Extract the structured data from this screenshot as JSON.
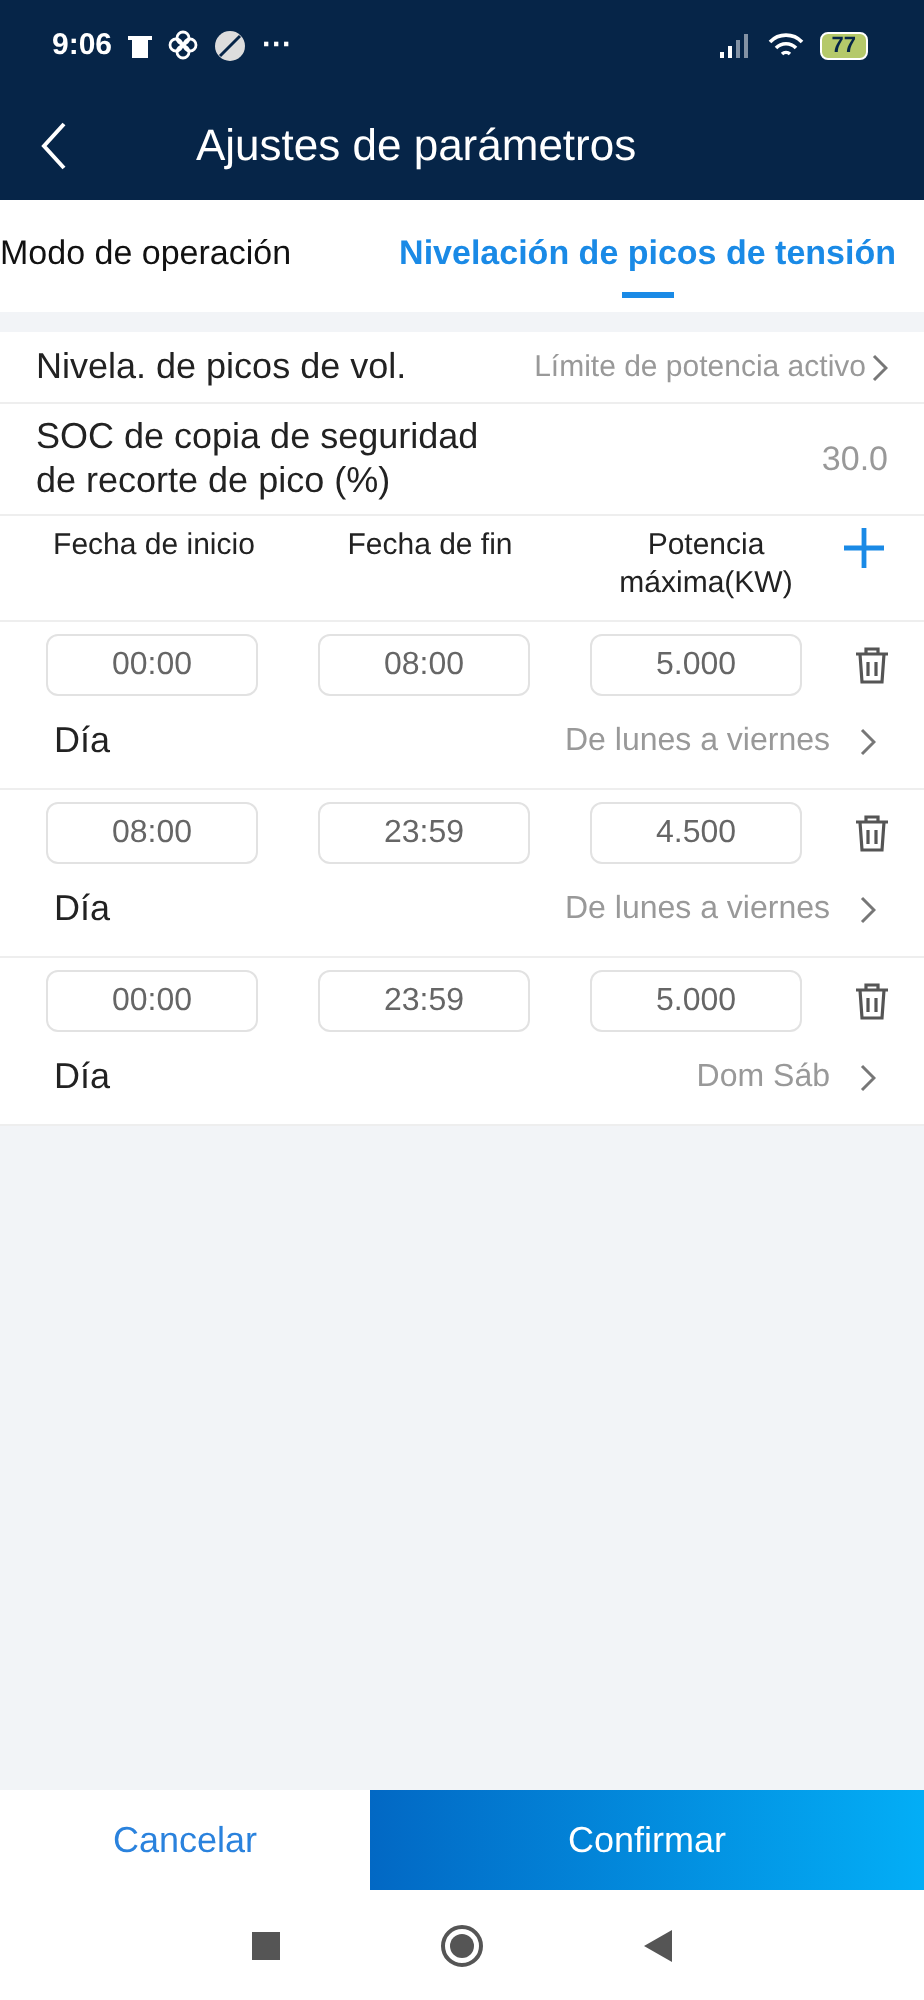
{
  "status_bar": {
    "time": "9:06",
    "more": "···",
    "battery": "77"
  },
  "header": {
    "title": "Ajustes de parámetros"
  },
  "tabs": [
    {
      "label": "Modo de operación",
      "selected": false
    },
    {
      "label": "Nivelación de picos de tensión",
      "selected": true
    }
  ],
  "settings": [
    {
      "label": "Nivela. de picos de vol.",
      "value": "Límite de potencia activo",
      "kind": "select"
    },
    {
      "label": "SOC de copia de seguridad de recorte de pico (%)",
      "value": "30.0",
      "kind": "number"
    }
  ],
  "schedule": {
    "columns": [
      "Fecha de inicio",
      "Fecha de fin",
      "Potencia máxima(KW)"
    ],
    "rows": [
      {
        "start": "00:00",
        "end": "08:00",
        "power": "5.000",
        "day_label": "Día",
        "days": "De lunes a viernes"
      },
      {
        "start": "08:00",
        "end": "23:59",
        "power": "4.500",
        "day_label": "Día",
        "days": "De lunes a viernes"
      },
      {
        "start": "00:00",
        "end": "23:59",
        "power": "5.000",
        "day_label": "Día",
        "days": "Dom Sáb"
      }
    ]
  },
  "buttons": {
    "cancel": "Cancelar",
    "confirm": "Confirmar"
  }
}
